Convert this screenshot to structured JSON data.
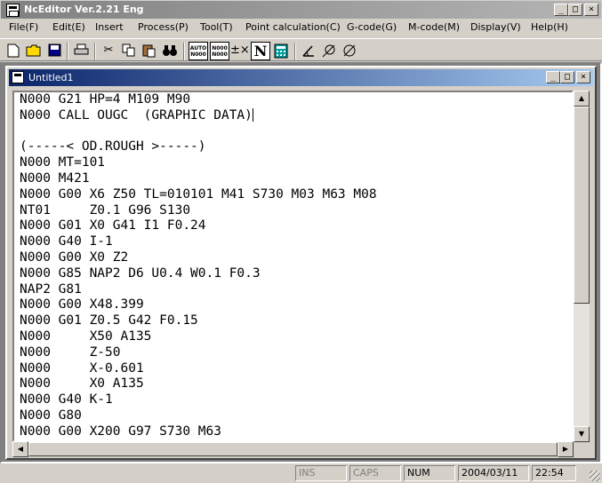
{
  "window": {
    "title": "NcEditor Ver.2.21 Eng"
  },
  "menu": [
    "File(F)",
    "Edit(E)",
    "Insert",
    "Process(P)",
    "Tool(T)",
    "Point calculation(C)",
    "G-code(G)",
    "M-code(M)",
    "Display(V)",
    "Help(H)"
  ],
  "toolbar": {
    "auto_label": "AUTO N000",
    "renumber_label": "N000 N000",
    "n_label": "N"
  },
  "document": {
    "title": "Untitled1",
    "lines": [
      "N000 G21 HP=4 M109 M90",
      "N000 CALL OUGC  (GRAPHIC DATA)",
      "",
      "(-----< OD.ROUGH >-----)",
      "N000 MT=101",
      "N000 M421",
      "N000 G00 X6 Z50 TL=010101 M41 S730 M03 M63 M08",
      "NT01     Z0.1 G96 S130",
      "N000 G01 X0 G41 I1 F0.24",
      "N000 G40 I-1",
      "N000 G00 X0 Z2",
      "N000 G85 NAP2 D6 U0.4 W0.1 F0.3",
      "NAP2 G81",
      "N000 G00 X48.399",
      "N000 G01 Z0.5 G42 F0.15",
      "N000     X50 A135",
      "N000     Z-50",
      "N000     X-0.601",
      "N000     X0 A135",
      "N000 G40 K-1",
      "N000 G80",
      "N000 G00 X200 G97 S730 M63"
    ]
  },
  "status": {
    "ins": "INS",
    "caps": "CAPS",
    "num": "NUM",
    "date": "2004/03/11",
    "time": "22:54"
  }
}
